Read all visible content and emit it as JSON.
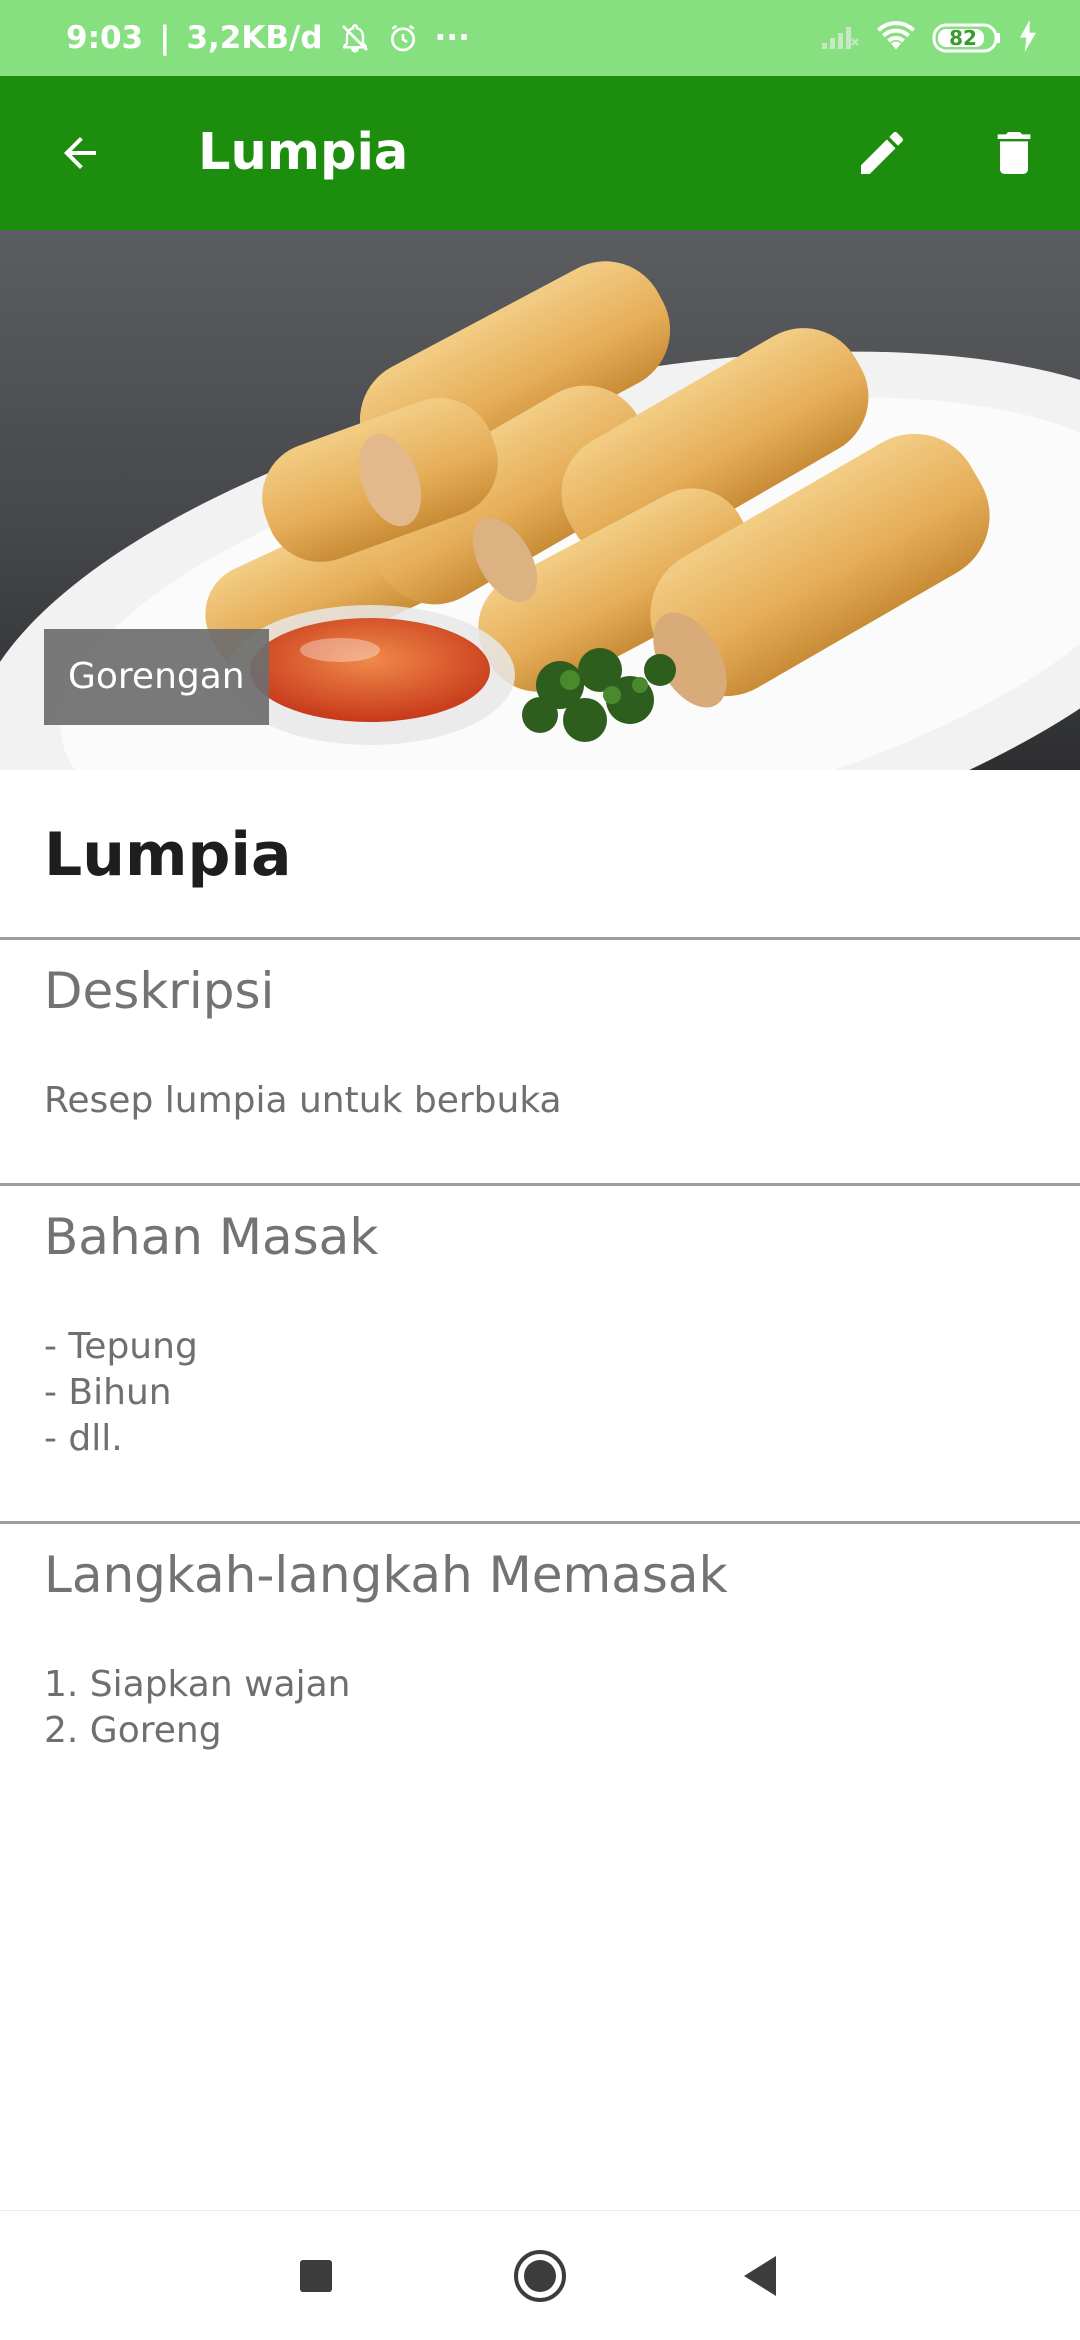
{
  "status_bar": {
    "time": "9:03",
    "network_speed": "3,2KB/d",
    "more": "···",
    "battery": "82"
  },
  "app_bar": {
    "title": "Lumpia",
    "icons": [
      "arrow-back-icon",
      "pencil-icon",
      "trash-icon"
    ]
  },
  "hero": {
    "category": "Gorengan"
  },
  "recipe": {
    "name": "Lumpia",
    "description": {
      "heading": "Deskripsi",
      "text": "Resep lumpia untuk berbuka"
    },
    "ingredients": {
      "heading": "Bahan Masak",
      "items": [
        "- Tepung",
        "- Bihun",
        "- dll."
      ]
    },
    "steps": {
      "heading": "Langkah-langkah Memasak",
      "items": [
        "1. Siapkan wajan",
        "2. Goreng"
      ]
    }
  },
  "colors": {
    "status_bar": "#87e07f",
    "app_bar": "#1d8d0e",
    "section_text": "#737373"
  },
  "nav_bar": {
    "icons": [
      "recents-square-icon",
      "home-circle-icon",
      "back-triangle-icon"
    ]
  }
}
